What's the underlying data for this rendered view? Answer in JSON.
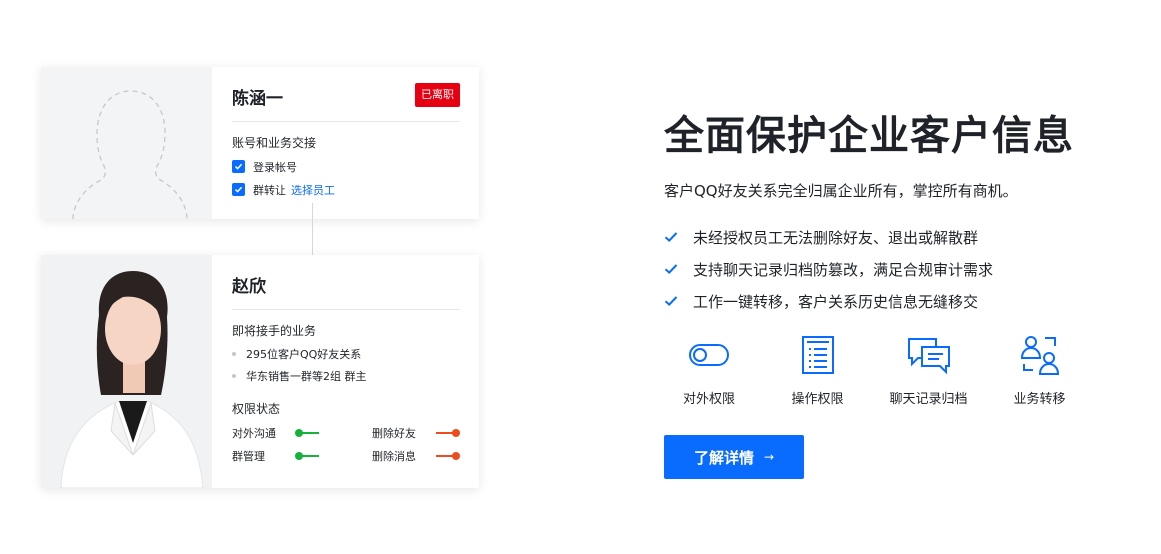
{
  "colors": {
    "accent": "#0a6cff",
    "badge": "#e60012",
    "toggle_on": "#15b33c",
    "toggle_off": "#ee4b1e"
  },
  "departed_card": {
    "name": "陈涵一",
    "status_badge": "已离职",
    "section_title": "账号和业务交接",
    "checks": [
      {
        "label": "登录帐号",
        "checked": true
      },
      {
        "label": "群转让",
        "checked": true,
        "link": "选择员工"
      }
    ]
  },
  "successor_card": {
    "name": "赵欣",
    "handover_title": "即将接手的业务",
    "handover_items": [
      "295位客户QQ好友关系",
      "华东销售一群等2组 群主"
    ],
    "permission_title": "权限状态",
    "permissions": [
      {
        "label": "对外沟通",
        "state": "on"
      },
      {
        "label": "删除好友",
        "state": "off"
      },
      {
        "label": "群管理",
        "state": "on"
      },
      {
        "label": "删除消息",
        "state": "off"
      }
    ]
  },
  "headline": "全面保护企业客户信息",
  "subtitle": "客户QQ好友关系完全归属企业所有，掌控所有商机。",
  "features": [
    "未经授权员工无法删除好友、退出或解散群",
    "支持聊天记录归档防篡改，满足合规审计需求",
    "工作一键转移，客户关系历史信息无缝移交"
  ],
  "capabilities": [
    {
      "label": "对外权限",
      "icon": "toggle-icon"
    },
    {
      "label": "操作权限",
      "icon": "list-document-icon"
    },
    {
      "label": "聊天记录归档",
      "icon": "chat-bubbles-icon"
    },
    {
      "label": "业务转移",
      "icon": "users-transfer-icon"
    }
  ],
  "cta": {
    "label": "了解详情",
    "arrow": "→"
  }
}
